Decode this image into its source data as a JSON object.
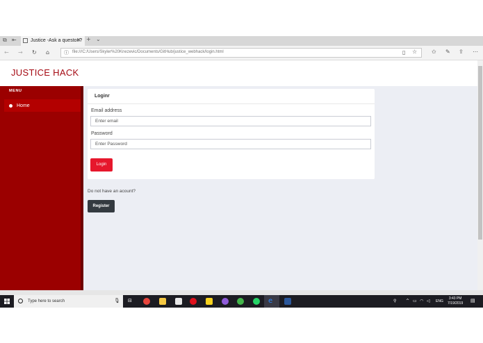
{
  "browser": {
    "tab_title": "Justice -Ask a queston?",
    "url": "file:///C:/Users/Skyler%20Knezevic/Documents/GitHub/justice_webhack/login.html"
  },
  "app": {
    "brand": "JUSTICE HACK",
    "menu_label": "MENU",
    "nav": [
      {
        "label": "Home",
        "icon": "home-icon"
      }
    ]
  },
  "login": {
    "title": "Loginr",
    "email_label": "Email address",
    "email_placeholder": "Enter email",
    "password_label": "Password",
    "password_placeholder": "Enter Password",
    "login_button": "Login",
    "no_account_text": "Do not have an acount?",
    "register_button": "Register"
  },
  "taskbar": {
    "search_placeholder": "Type here to search",
    "lang": "ENG",
    "time": "3:43 PM",
    "date": "7/19/2019"
  },
  "colors": {
    "brand_red": "#a50a13",
    "sidebar": "#9b0000",
    "login_button": "#e6172c",
    "register_button": "#343a40"
  }
}
